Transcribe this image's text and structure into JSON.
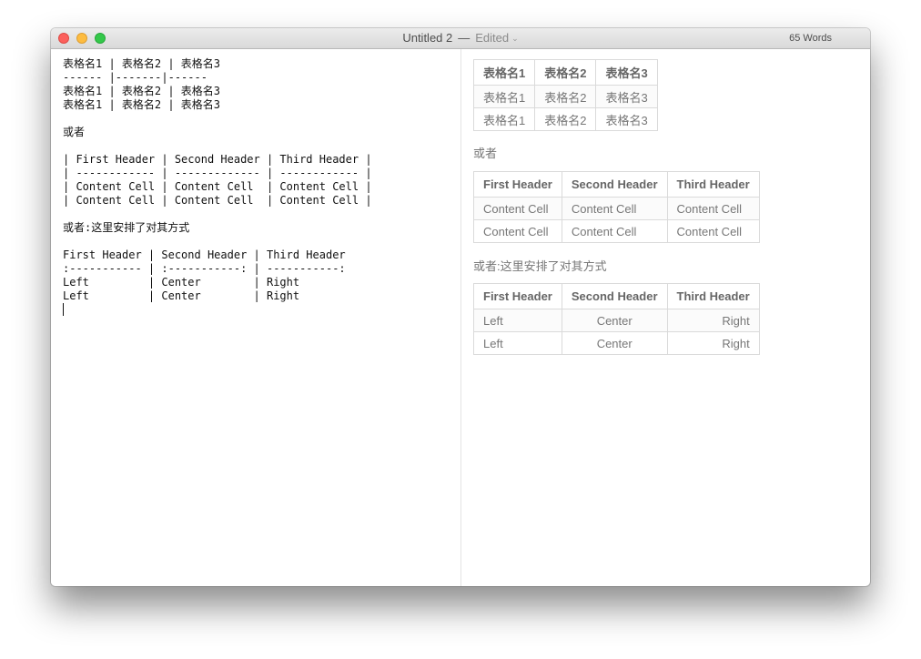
{
  "window": {
    "title": "Untitled 2",
    "separator": "—",
    "status": "Edited",
    "word_count": "65 Words"
  },
  "editor": {
    "source_lines": [
      "表格名1 | 表格名2 | 表格名3",
      "------ |-------|------",
      "表格名1 | 表格名2 | 表格名3",
      "表格名1 | 表格名2 | 表格名3",
      "",
      "或者",
      "",
      "| First Header | Second Header | Third Header |",
      "| ------------ | ------------- | ------------ |",
      "| Content Cell | Content Cell  | Content Cell |",
      "| Content Cell | Content Cell  | Content Cell |",
      "",
      "或者:这里安排了对其方式",
      "",
      "First Header | Second Header | Third Header",
      ":----------- | :-----------: | -----------:",
      "Left         | Center        | Right",
      "Left         | Center        | Right"
    ]
  },
  "preview": {
    "table1": {
      "headers": [
        "表格名1",
        "表格名2",
        "表格名3"
      ],
      "rows": [
        [
          "表格名1",
          "表格名2",
          "表格名3"
        ],
        [
          "表格名1",
          "表格名2",
          "表格名3"
        ]
      ]
    },
    "para1": "或者",
    "table2": {
      "headers": [
        "First Header",
        "Second Header",
        "Third Header"
      ],
      "rows": [
        [
          "Content Cell",
          "Content Cell",
          "Content Cell"
        ],
        [
          "Content Cell",
          "Content Cell",
          "Content Cell"
        ]
      ]
    },
    "para2": "或者:这里安排了对其方式",
    "table3": {
      "headers": [
        "First Header",
        "Second Header",
        "Third Header"
      ],
      "rows": [
        [
          "Left",
          "Center",
          "Right"
        ],
        [
          "Left",
          "Center",
          "Right"
        ]
      ]
    }
  },
  "colors": {
    "close": "#fc605c",
    "minimize": "#fdbc40",
    "zoom": "#34c84a"
  }
}
